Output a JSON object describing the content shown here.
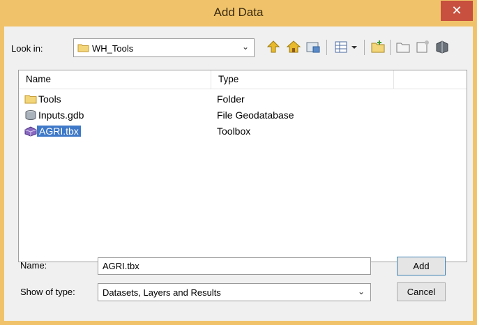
{
  "window": {
    "title": "Add Data",
    "close_glyph": "✕"
  },
  "look_in": {
    "label": "Look in:",
    "value": "WH_Tools"
  },
  "toolbar": {
    "icons": [
      "up-one-level-icon",
      "home-icon",
      "connect-folder-icon",
      "view-options-icon",
      "new-folder-icon",
      "new-geodatabase-icon",
      "new-file-icon",
      "catalog-icon"
    ]
  },
  "list": {
    "columns": [
      "Name",
      "Type"
    ],
    "rows": [
      {
        "name": "Tools",
        "type": "Folder",
        "icon": "folder-icon"
      },
      {
        "name": "Inputs.gdb",
        "type": "File Geodatabase",
        "icon": "geodatabase-icon"
      },
      {
        "name": "AGRI.tbx",
        "type": "Toolbox",
        "icon": "toolbox-icon",
        "selected": true
      }
    ]
  },
  "name_field": {
    "label": "Name:",
    "value": "AGRI.tbx"
  },
  "type_field": {
    "label": "Show of type:",
    "value": "Datasets, Layers and Results"
  },
  "buttons": {
    "add": "Add",
    "cancel": "Cancel"
  },
  "colors": {
    "title_bar": "#f0c36a",
    "close": "#c7503f",
    "selection": "#3f79c8"
  }
}
